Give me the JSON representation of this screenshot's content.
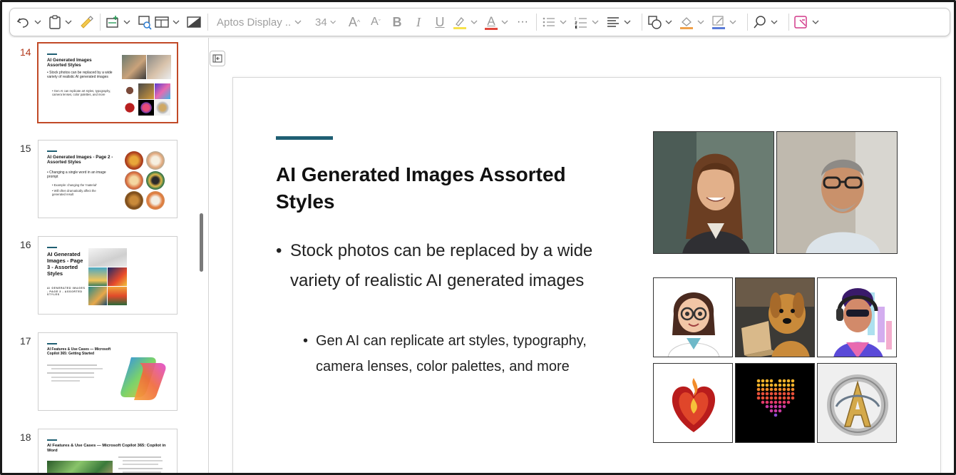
{
  "toolbar": {
    "font_name": "Aptos Display ...",
    "font_size": "34",
    "grow_font": "A",
    "shrink_font": "A",
    "bold": "B",
    "italic": "I",
    "underline": "U",
    "font_color_letter": "A",
    "more": "···",
    "colors": {
      "highlight": "#f7e24b",
      "font_color": "#e0463c",
      "shape_fill": "#f0a14a",
      "outline": "#5a7bd8",
      "designer": "#d23a8a"
    }
  },
  "thumbnails": [
    {
      "number": "14",
      "active": true,
      "title": "AI Generated Images Assorted Styles",
      "bullets": [
        "Stock photos can be replaced by a wide variety of realistic AI generated images"
      ],
      "sub_bullets": [
        "Gen AI can replicate art styles, typography, camera lenses, color palettes, and more"
      ]
    },
    {
      "number": "15",
      "active": false,
      "title": "AI Generated Images - Page 2 - Assorted Styles",
      "bullets": [
        "Changing a single word in an image prompt"
      ],
      "sub_bullets": [
        "Example: changing the 'material'",
        "Will often dramatically affect the generated result"
      ]
    },
    {
      "number": "16",
      "active": false,
      "title": "AI Generated Images - Page 3 - Assorted Styles",
      "caption": "AI GENERATED IMAGES - PAGE 3 - ASSORTED STYLES"
    },
    {
      "number": "17",
      "active": false,
      "title": "AI Features & Use Cases — Microsoft Copilot 365: Getting Started"
    },
    {
      "number": "18",
      "active": false,
      "title": "AI Features & Use Cases — Microsoft Copilot 365: Copilot in Word"
    }
  ],
  "slide": {
    "title": "AI Generated Images Assorted Styles",
    "bullet": "Stock photos can be replaced by a wide variety of realistic AI generated images",
    "sub_bullet": "Gen AI can replicate art styles, typography, camera lenses, color palettes, and more",
    "bullet_glyph": "•",
    "accent_color": "#1f5f73"
  }
}
